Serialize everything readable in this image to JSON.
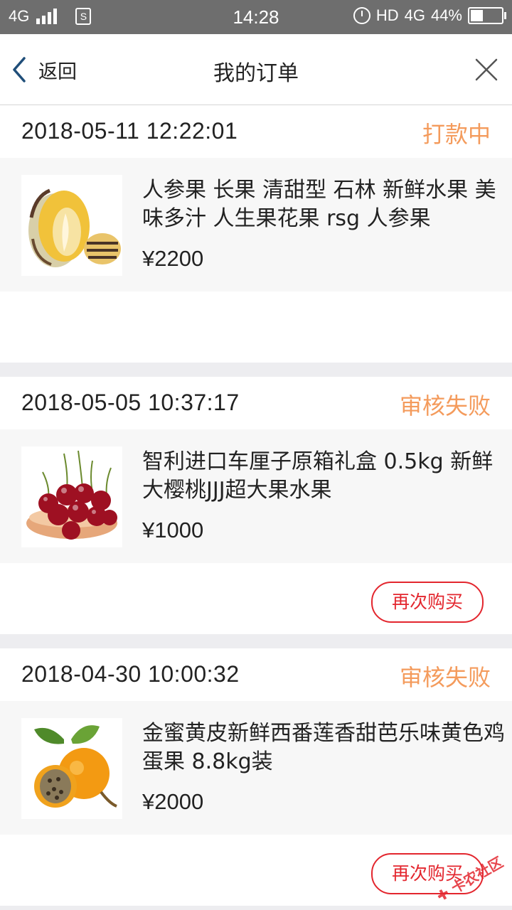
{
  "status_bar": {
    "network_left": "4G",
    "sim_icon": "S",
    "time": "14:28",
    "hd_label": "HD",
    "network_right": "4G",
    "battery_percent": "44%",
    "battery_level": 0.44
  },
  "nav": {
    "back_label": "返回",
    "title": "我的订单",
    "icons": {
      "back": "chevron-left-icon",
      "close": "close-icon"
    },
    "back_color": "#1f4e79"
  },
  "orders": [
    {
      "time": "2018-05-11 12:22:01",
      "status": "打款中",
      "product_name": "人参果 长果 清甜型 石林 新鲜水果 美味多汁 人生果花果 rsg 人参果",
      "price": "¥2200",
      "image": "ginseng-fruit",
      "rebuy_label": ""
    },
    {
      "time": "2018-05-05 10:37:17",
      "status": "审核失败",
      "product_name": "智利进口车厘子原箱礼盒 0.5kg 新鲜大樱桃JJJ超大果水果",
      "price": "¥1000",
      "image": "cherries",
      "rebuy_label": "再次购买"
    },
    {
      "time": "2018-04-30 10:00:32",
      "status": "审核失败",
      "product_name": "金蜜黄皮新鲜西番莲香甜芭乐味黄色鸡蛋果 8.8kg装",
      "price": "¥2000",
      "image": "passion-fruit",
      "rebuy_label": "再次购买"
    }
  ],
  "colors": {
    "status": "#f49b5c",
    "rebuy": "#e3262e",
    "background": "#ededf0"
  },
  "watermark": "卡农社区"
}
